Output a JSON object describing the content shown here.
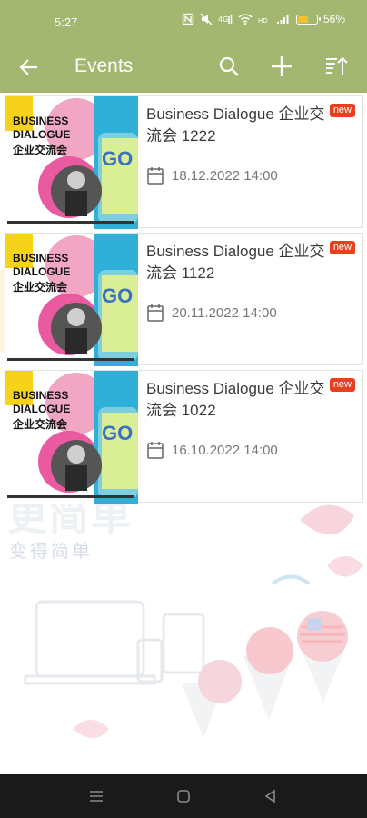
{
  "status": {
    "time": "5:27",
    "battery_percent": "56%",
    "battery_level": 0.56
  },
  "app_bar": {
    "title": "Events"
  },
  "background_text": {
    "line1": "更简单",
    "line2": "变得简单"
  },
  "events": [
    {
      "title": "Business Dialogue 企业交流会 1222",
      "date": "18.12.2022 14:00",
      "badge": "new",
      "thumb_cn": "企业交流会",
      "thumb_brand_1": "BUSINESS",
      "thumb_brand_2": "DIALOGUE"
    },
    {
      "title": "Business Dialogue 企业交流会 1122",
      "date": "20.11.2022 14:00",
      "badge": "new",
      "thumb_cn": "企业交流会",
      "thumb_brand_1": "BUSINESS",
      "thumb_brand_2": "DIALOGUE"
    },
    {
      "title": "Business Dialogue 企业交流会 1022",
      "date": "16.10.2022 14:00",
      "badge": "new",
      "thumb_cn": "企业交流会",
      "thumb_brand_1": "BUSINESS",
      "thumb_brand_2": "DIALOGUE"
    }
  ],
  "colors": {
    "app_bar": "#a4b770",
    "badge": "#e8401f"
  },
  "icons": {
    "back": "arrow-back-icon",
    "search": "search-icon",
    "add": "plus-icon",
    "sort": "sort-icon",
    "calendar": "calendar-icon"
  }
}
